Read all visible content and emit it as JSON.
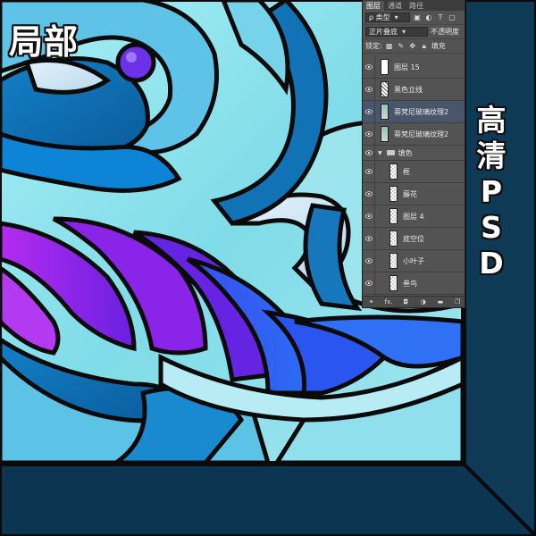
{
  "overlay": {
    "top_left_label": "局部",
    "side_label_chars": [
      "高",
      "清",
      "P",
      "S",
      "D"
    ]
  },
  "layers_panel": {
    "tabs": [
      {
        "label": "图层",
        "active": true
      },
      {
        "label": "通道",
        "active": false
      },
      {
        "label": "路径",
        "active": false
      }
    ],
    "filter_kind": "ρ 类型",
    "blend_mode": "正片叠底",
    "opacity_label": "不透明度",
    "lock_label": "锁定:",
    "fill_label": "填充",
    "icons": {
      "filter": [
        "image-filter-icon",
        "adjustment-filter-icon",
        "type-filter-icon",
        "shape-filter-icon"
      ],
      "lock": [
        "lock-pixels-icon",
        "lock-paint-icon",
        "lock-position-icon",
        "lock-all-icon"
      ],
      "footer": [
        "link-icon",
        "fx-icon",
        "mask-icon",
        "adjustment-icon",
        "folder-icon",
        "new-layer-icon"
      ]
    },
    "fx_label": "fx.",
    "layers": [
      {
        "name": "图层 15",
        "thumb": "white",
        "indented": false,
        "selected": false
      },
      {
        "name": "黑色立线",
        "thumb": "dots",
        "indented": false,
        "selected": false
      },
      {
        "name": "蒂梵尼玻璃纹理2",
        "thumb": "pattern",
        "indented": false,
        "selected": true
      },
      {
        "name": "蒂梵尼玻璃纹理2",
        "thumb": "pattern",
        "indented": false,
        "selected": false
      },
      {
        "name": "填色",
        "thumb": "group",
        "indented": false,
        "selected": false
      },
      {
        "name": "框",
        "thumb": "checker",
        "indented": true,
        "selected": false
      },
      {
        "name": "藤花",
        "thumb": "checker",
        "indented": true,
        "selected": false
      },
      {
        "name": "图层 4",
        "thumb": "checker",
        "indented": true,
        "selected": false
      },
      {
        "name": "底空位",
        "thumb": "checker",
        "indented": true,
        "selected": false
      },
      {
        "name": "小叶子",
        "thumb": "checker",
        "indented": true,
        "selected": false
      },
      {
        "name": "叁鸟",
        "thumb": "checker",
        "indented": true,
        "selected": false
      }
    ]
  },
  "colors": {
    "frame": "#0d3148",
    "glass_light": "#8ee3ef",
    "ribbon_purple": "#7a1ee0",
    "ribbon_blue": "#2f5cf0",
    "lead": "#0a0a0a"
  }
}
